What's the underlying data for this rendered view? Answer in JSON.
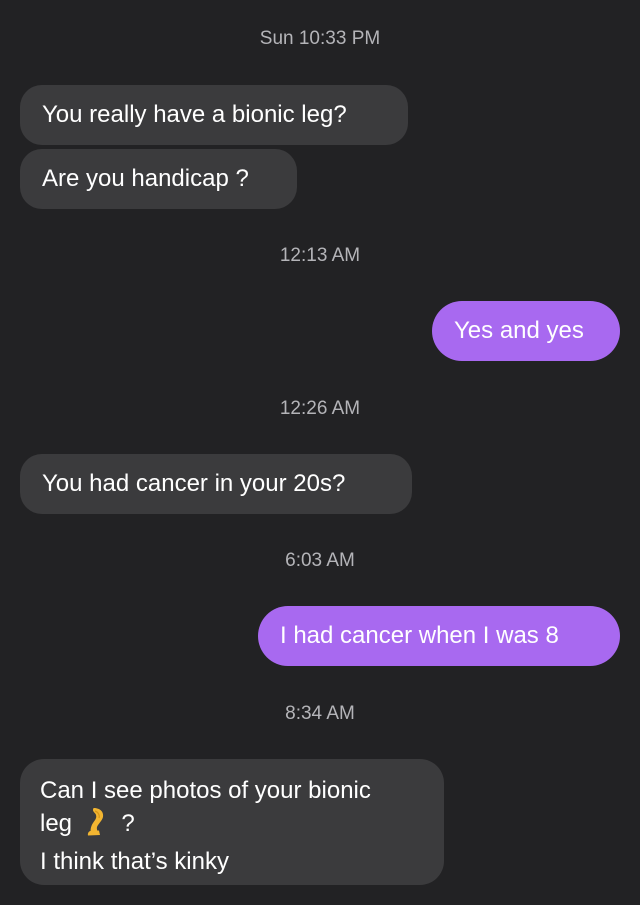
{
  "conversation": {
    "timestamps": [
      "Sun 10:33 PM",
      "12:13 AM",
      "12:26 AM",
      "6:03 AM",
      "8:34 AM"
    ],
    "messages": [
      {
        "sender": "them",
        "text": "You really have a bionic leg?"
      },
      {
        "sender": "them",
        "text": "Are you handicap ?"
      },
      {
        "sender": "me",
        "text": "Yes and yes"
      },
      {
        "sender": "them",
        "text": "You had cancer in your 20s?"
      },
      {
        "sender": "me",
        "text": "I had cancer when I was 8"
      },
      {
        "sender": "them",
        "lines": [
          "Can I see photos of your bionic",
          "leg",
          "?",
          "I think that’s kinky"
        ],
        "emoji": "leg-emoji"
      }
    ]
  },
  "colors": {
    "background": "#222224",
    "incoming_bubble": "#3b3b3d",
    "outgoing_bubble": "#a869f0",
    "timestamp_text": "#b4b4b8"
  }
}
